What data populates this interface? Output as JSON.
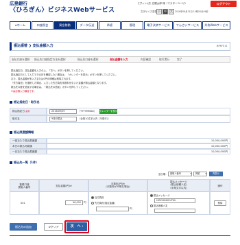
{
  "header": {
    "logo_line1": "広島銀行",
    "logo_line2": "〈ひろぎん〉ビジネスWebサービス",
    "user_info": "【ヴィンガ】広銀太郎 様（マスターユーザ）",
    "logout": "ログアウト",
    "font_size_label": "文字サイズ変更",
    "font_sizes": [
      "小",
      "中",
      "大"
    ],
    "last_login": "2016年08月31日 10時50分49秒"
  },
  "nav": {
    "items": [
      "ホーム",
      "口座照会",
      "資金移動",
      "データ伝送",
      "承認",
      "管理",
      "電子決済サービス",
      "でんさいサービス",
      "外為Webサービス"
    ]
  },
  "page": {
    "title": "振込振替 ❯ 支払金額入力",
    "screen_id": "BFKF011"
  },
  "steps": [
    "支払口座を選択",
    "振込先口座指定方法を選択",
    "振込先口座を選択",
    "支払金額を入力",
    "内容確認",
    "取引実行",
    "完了"
  ],
  "instructions": [
    "振込指定日、支払金額を入力の上、「次へ」ボタンを押してください。",
    "振込指定日として入力できる日を確認したい場合は、「カレンダーを表示」ボタンを押してください。",
    "また、振込金額が未入力または0円の明細は削除されます。",
    "『先方負担』を選択した場合、入力した先方負担手数料を引いた金額が振込金額となります。",
    "振込先口座を追加する場合は、「振込先の追加」ボタンを押してください。",
    "※は必須入力項目です。"
  ],
  "section1": {
    "heading": "振込指定日・取引名",
    "date_label": "振込指定日",
    "required": "必須",
    "date_value": "2016/09/09",
    "date_hint": "［YYYYMMDD］",
    "calendar_btn": "カレンダーを表示",
    "name_label": "取引名",
    "name_value": "9月分振込",
    "name_hint": "（全角10文字以内［半角可］）"
  },
  "section2": {
    "heading": "振込限度額情報",
    "rows": [
      {
        "label": "一回当たり振込限度額",
        "value": "10,000,000円"
      },
      {
        "label": "本日の振込可能額",
        "value": "10,000,000円"
      },
      {
        "label": "一日当たり振込限度額",
        "value": "10,000,000円"
      }
    ]
  },
  "section3": {
    "heading": "振込先一覧（1件）",
    "sort_label": "並び順：",
    "sort_value": "受取人番号",
    "asc_value": "昇順",
    "sort_btn": "再表示",
    "columns": [
      "登録口座\n受取人番号",
      "支払金額(円)※",
      "手数料(円)※\n(手数料が不明な場合)",
      "振込メッセージ\n(振込依頼人名)\n(半角文字以内)",
      "操作"
    ],
    "rows": [
      {
        "num": "001",
        "amount": "96,000",
        "unit": "円",
        "fee_option1": "当方負担",
        "fee_option2": "先方負担(指定金額)",
        "fee_unit": "円",
        "msg_option1": "振込メッセージ",
        "msg_option2": "振込依頼人名",
        "msg_value": "HIROGINKOUTKU",
        "delete": "削除"
      }
    ]
  },
  "footer_buttons": {
    "add": "振込先の追加",
    "clear": "クリア",
    "next": "次　へ"
  }
}
